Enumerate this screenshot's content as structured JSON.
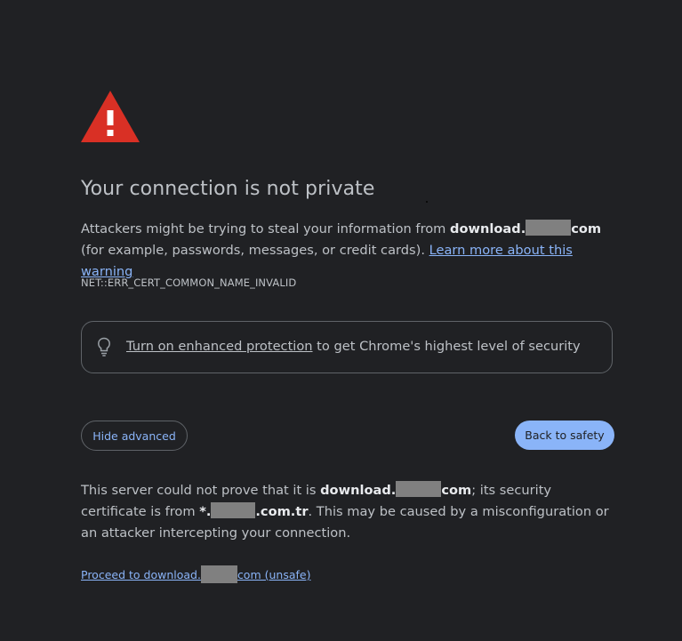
{
  "page": {
    "title": "Your connection is not private",
    "error_code": "NET::ERR_CERT_COMMON_NAME_INVALID"
  },
  "intro": {
    "text_before": "Attackers might be trying to steal your information from ",
    "domain_prefix": "download.",
    "domain_suffix": "com",
    "text_after": " (for example, passwords, messages, or credit cards). ",
    "learn_more_link": "Learn more about this warning"
  },
  "enhanced_protection": {
    "icon": "lightbulb-icon",
    "link": "Turn on enhanced protection",
    "text": " to get Chrome's highest level of security"
  },
  "buttons": {
    "hide_advanced": "Hide advanced",
    "back_to_safety": "Back to safety"
  },
  "details": {
    "text_before": "This server could not prove that it is ",
    "domain_prefix": "download.",
    "domain_suffix": "com",
    "text_middle": "; its security certificate is from ",
    "cert_prefix": "*.",
    "cert_suffix": ".com.tr",
    "text_after": ". This may be caused by a misconfiguration or an attacker intercepting your connection."
  },
  "proceed": {
    "prefix": "Proceed to download.",
    "suffix": "com (unsafe)"
  },
  "colors": {
    "background": "#202124",
    "text": "#bdc1c6",
    "link": "#8ab4f8",
    "warning_red": "#db4437",
    "button_primary": "#8ab4f8",
    "redaction": "#808080"
  }
}
